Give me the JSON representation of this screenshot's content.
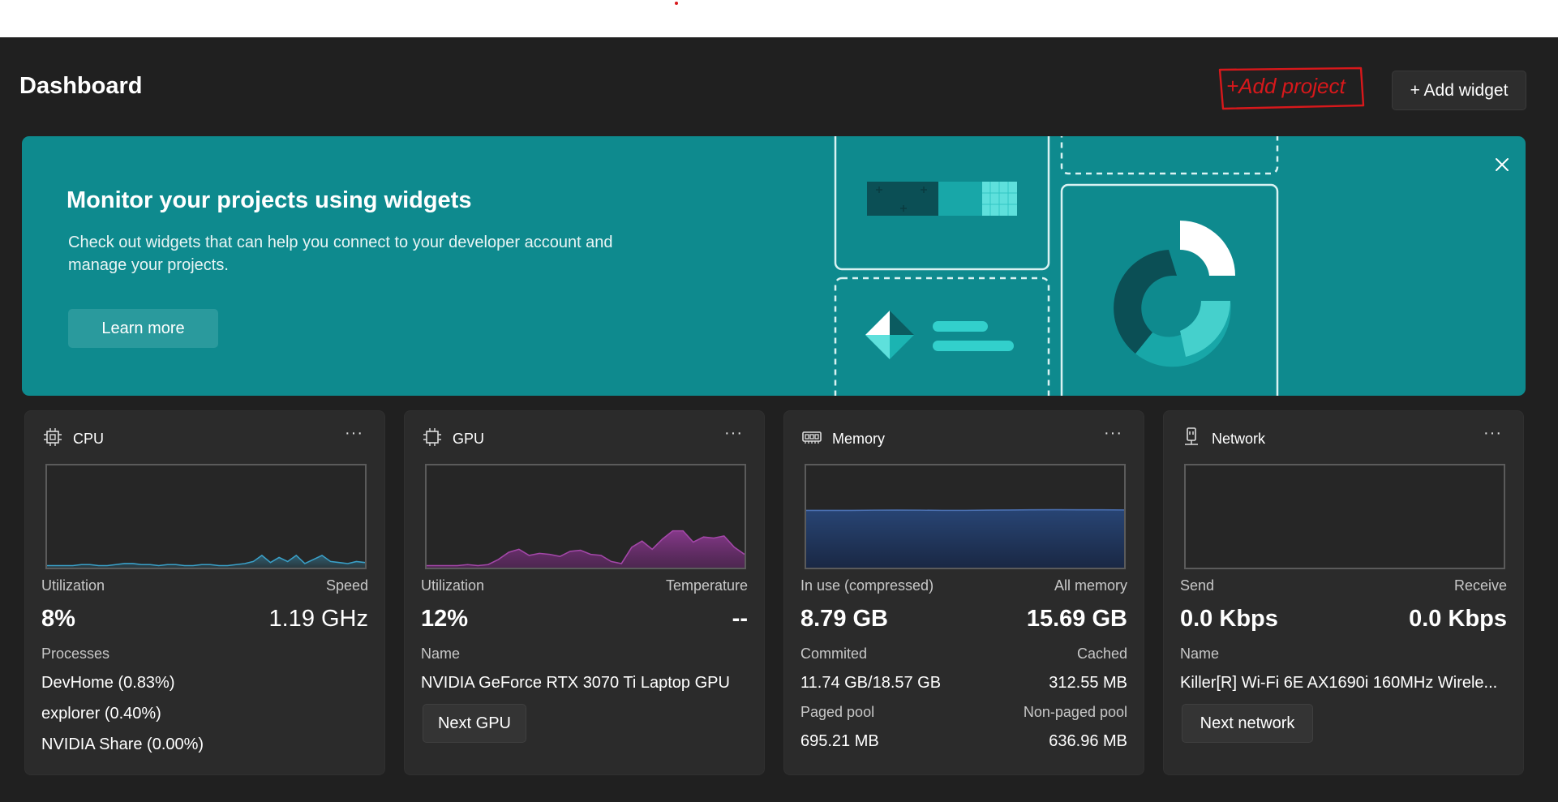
{
  "header": {
    "title": "Dashboard",
    "add_widget_label": "+ Add widget",
    "annotation_text": "+Add project",
    "annotation_color": "#d8181b"
  },
  "banner": {
    "title": "Monitor your projects using widgets",
    "description": "Check out widgets that can help you connect to your developer account and manage your projects.",
    "learn_more_label": "Learn more",
    "close_icon": "close-icon",
    "background": "#0e8a8e"
  },
  "widgets": {
    "cpu": {
      "title": "CPU",
      "icon": "cpu-chip-icon",
      "more": "···",
      "left_label": "Utilization",
      "right_label": "Speed",
      "left_value": "8%",
      "right_value": "1.19 GHz",
      "section_label": "Processes",
      "processes": [
        "DevHome (0.83%)",
        "explorer (0.40%)",
        "NVIDIA Share (0.00%)"
      ],
      "graph_color": "#3aa0c8",
      "history": [
        2,
        2,
        2,
        2,
        3,
        3,
        2,
        2,
        3,
        4,
        4,
        3,
        3,
        2,
        3,
        3,
        2,
        2,
        3,
        3,
        2,
        2,
        3,
        4,
        6,
        12,
        5,
        10,
        6,
        12,
        4,
        8,
        12,
        6,
        5,
        4,
        6,
        5
      ]
    },
    "gpu": {
      "title": "GPU",
      "icon": "gpu-chip-icon",
      "more": "···",
      "left_label": "Utilization",
      "right_label": "Temperature",
      "left_value": "12%",
      "right_value": "--",
      "name_label": "Name",
      "name_value": "NVIDIA GeForce RTX 3070 Ti Laptop GPU",
      "button_label": "Next GPU",
      "graph_color": "#a347a8",
      "history": [
        2,
        2,
        2,
        2,
        3,
        2,
        3,
        8,
        15,
        18,
        12,
        14,
        13,
        11,
        16,
        17,
        13,
        12,
        6,
        4,
        20,
        26,
        18,
        28,
        36,
        36,
        25,
        30,
        29,
        31,
        20,
        13
      ]
    },
    "memory": {
      "title": "Memory",
      "icon": "memory-icon",
      "more": "···",
      "left_label": "In use (compressed)",
      "right_label": "All memory",
      "left_value": "8.79 GB",
      "right_value": "15.69 GB",
      "committed_label": "Commited",
      "committed_value": "11.74 GB/18.57 GB",
      "cached_label": "Cached",
      "cached_value": "312.55 MB",
      "paged_label": "Paged pool",
      "paged_value": "695.21 MB",
      "nonpaged_label": "Non-paged pool",
      "nonpaged_value": "636.96 MB",
      "graph_color": "#4a6fb0",
      "history": [
        56,
        56,
        56,
        56.2,
        56.3,
        56.2,
        56.1,
        56.1,
        56.3,
        56.4,
        56.6,
        56.7,
        56.6,
        56.6,
        56.5
      ]
    },
    "network": {
      "title": "Network",
      "icon": "network-adapter-icon",
      "more": "···",
      "left_label": "Send",
      "right_label": "Receive",
      "left_value": "0.0 Kbps",
      "right_value": "0.0 Kbps",
      "name_label": "Name",
      "name_value": "Killer[R] Wi-Fi 6E AX1690i 160MHz Wirele...",
      "button_label": "Next network"
    }
  }
}
